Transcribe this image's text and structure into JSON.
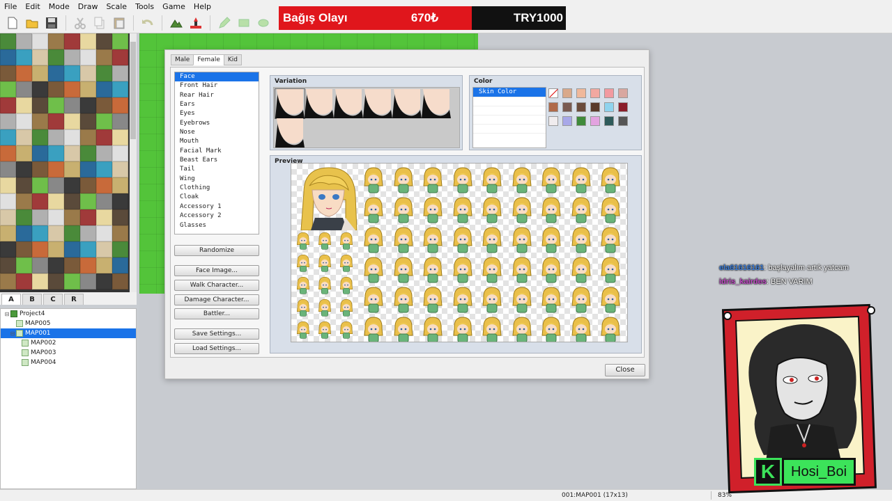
{
  "menubar": {
    "items": [
      "File",
      "Edit",
      "Mode",
      "Draw",
      "Scale",
      "Tools",
      "Game",
      "Help"
    ]
  },
  "toolbar": {
    "icons": [
      "new-project-icon",
      "open-project-icon",
      "save-project-icon",
      "cut-icon",
      "copy-icon",
      "paste-icon",
      "undo-icon",
      "map-mode-icon",
      "event-mode-icon",
      "pencil-icon",
      "rectangle-icon",
      "ellipse-icon"
    ]
  },
  "donation": {
    "title": "Bağış Olayı",
    "amount": "670₺",
    "goal": "TRY1000",
    "colors": {
      "bar": "#e0161c",
      "remaining": "#111111"
    }
  },
  "tileset_tabs": [
    "A",
    "B",
    "C",
    "R"
  ],
  "map_tree": [
    {
      "label": "Project4",
      "kind": "project",
      "level": 0,
      "selected": false
    },
    {
      "label": "MAP005",
      "kind": "map",
      "level": 1,
      "selected": false
    },
    {
      "label": "MAP001",
      "kind": "map",
      "level": 1,
      "selected": true
    },
    {
      "label": "MAP002",
      "kind": "map",
      "level": 2,
      "selected": false
    },
    {
      "label": "MAP003",
      "kind": "map",
      "level": 2,
      "selected": false
    },
    {
      "label": "MAP004",
      "kind": "map",
      "level": 2,
      "selected": false
    }
  ],
  "dialog": {
    "tabs": [
      "Male",
      "Female",
      "Kid"
    ],
    "active_tab": "Female",
    "parts": [
      "Face",
      "Front Hair",
      "Rear Hair",
      "Ears",
      "Eyes",
      "Eyebrows",
      "Nose",
      "Mouth",
      "Facial Mark",
      "Beast Ears",
      "Tail",
      "Wing",
      "Clothing",
      "Cloak",
      "Accessory 1",
      "Accessory 2",
      "Glasses"
    ],
    "selected_part": "Face",
    "buttons": {
      "randomize": "Randomize",
      "face_image": "Face Image...",
      "walk_character": "Walk Character...",
      "damage_character": "Damage Character...",
      "battler": "Battler...",
      "save_settings": "Save Settings...",
      "load_settings": "Load Settings..."
    },
    "variation": {
      "title": "Variation",
      "count": 7,
      "selected_index": 0
    },
    "color": {
      "title": "Color",
      "items": [
        "Skin Color"
      ],
      "selected": "Skin Color",
      "swatches": [
        "none",
        "#d9a98a",
        "#f0b89a",
        "#f2a8a0",
        "#f29aa0",
        "#d8a7a0",
        "#b06a4a",
        "#7a5a50",
        "#6b4b3b",
        "#5a3a2a",
        "#8fd3ee",
        "#8a1d2a",
        "#f0ecee",
        "#a8a8e8",
        "#3f8a3a",
        "#e3a3e0",
        "#2e5a5a",
        "#555555"
      ]
    },
    "preview": {
      "title": "Preview"
    },
    "close": "Close"
  },
  "statusbar": {
    "map": "001:MAP001 (17x13)",
    "zoom": "83%"
  },
  "chat": [
    {
      "user": "ela61616161",
      "message": ": başlayalım artık yatcam"
    },
    {
      "user": "idris_kairdes",
      "message": ": BEN VARIM"
    }
  ],
  "streamer": {
    "badge": "K",
    "name": "Hosi_Boi",
    "colors": {
      "frame": "#d0202a",
      "accent": "#3ce35a"
    }
  }
}
